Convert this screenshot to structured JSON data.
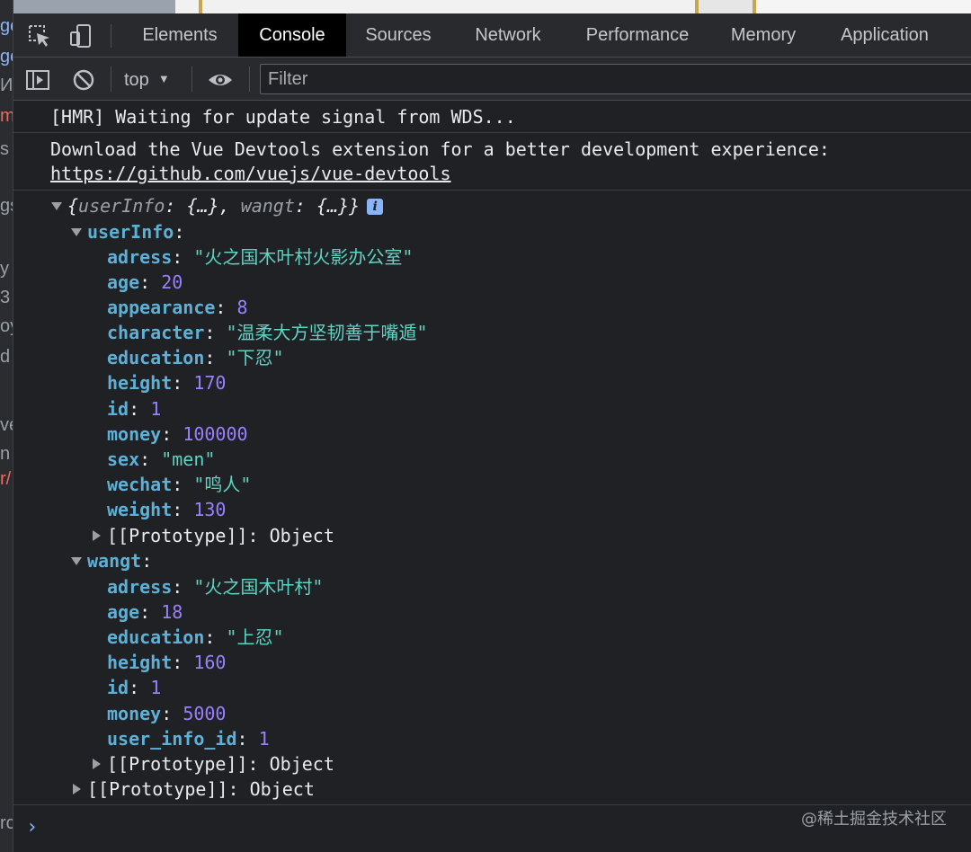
{
  "left_fragments": [
    {
      "text": "ge",
      "kind": "blue"
    },
    {
      "text": "ge",
      "kind": "blue"
    },
    {
      "text": "ИE",
      "kind": "plain"
    },
    {
      "text": "m",
      "kind": "red"
    },
    {
      "text": "s",
      "kind": "plain"
    },
    {
      "text": "gs",
      "kind": "plain"
    },
    {
      "text": "y",
      "kind": "plain"
    },
    {
      "text": "3",
      "kind": "plain"
    },
    {
      "text": "oy",
      "kind": "plain"
    },
    {
      "text": "d",
      "kind": "plain"
    },
    {
      "text": "ve",
      "kind": "plain"
    },
    {
      "text": "n",
      "kind": "plain"
    },
    {
      "text": "r/",
      "kind": "red"
    },
    {
      "text": "rc",
      "kind": "plain"
    }
  ],
  "tabs": [
    {
      "label": "Elements",
      "active": false
    },
    {
      "label": "Console",
      "active": true
    },
    {
      "label": "Sources",
      "active": false
    },
    {
      "label": "Network",
      "active": false
    },
    {
      "label": "Performance",
      "active": false
    },
    {
      "label": "Memory",
      "active": false
    },
    {
      "label": "Application",
      "active": false
    }
  ],
  "toolbar": {
    "context": "top",
    "filter_placeholder": "Filter"
  },
  "messages": {
    "hmr": "[HMR] Waiting for update signal from WDS...",
    "vue_text": "Download the Vue Devtools extension for a better development experience:",
    "vue_link": "https://github.com/vuejs/vue-devtools"
  },
  "object_preview": {
    "open": "{",
    "k1": "userInfo",
    "v1": "{…}",
    "k2": "wangt",
    "v2": "{…}",
    "close": "}",
    "info_badge": "i"
  },
  "userInfo": {
    "label": "userInfo",
    "props": [
      {
        "key": "adress",
        "value": "\"火之国木叶村火影办公室\"",
        "type": "str"
      },
      {
        "key": "age",
        "value": "20",
        "type": "num"
      },
      {
        "key": "appearance",
        "value": "8",
        "type": "num"
      },
      {
        "key": "character",
        "value": "\"温柔大方坚韧善于嘴遁\"",
        "type": "str"
      },
      {
        "key": "education",
        "value": "\"下忍\"",
        "type": "str"
      },
      {
        "key": "height",
        "value": "170",
        "type": "num"
      },
      {
        "key": "id",
        "value": "1",
        "type": "num"
      },
      {
        "key": "money",
        "value": "100000",
        "type": "num"
      },
      {
        "key": "sex",
        "value": "\"men\"",
        "type": "str"
      },
      {
        "key": "wechat",
        "value": "\"鸣人\"",
        "type": "str"
      },
      {
        "key": "weight",
        "value": "130",
        "type": "num"
      }
    ],
    "prototype": "[[Prototype]]",
    "prototype_value": "Object"
  },
  "wangt": {
    "label": "wangt",
    "props": [
      {
        "key": "adress",
        "value": "\"火之国木叶村\"",
        "type": "str"
      },
      {
        "key": "age",
        "value": "18",
        "type": "num"
      },
      {
        "key": "education",
        "value": "\"上忍\"",
        "type": "str"
      },
      {
        "key": "height",
        "value": "160",
        "type": "num"
      },
      {
        "key": "id",
        "value": "1",
        "type": "num"
      },
      {
        "key": "money",
        "value": "5000",
        "type": "num"
      },
      {
        "key": "user_info_id",
        "value": "1",
        "type": "num"
      }
    ],
    "prototype": "[[Prototype]]",
    "prototype_value": "Object"
  },
  "root_prototype": "[[Prototype]]",
  "root_prototype_value": "Object",
  "prompt_symbol": "›",
  "watermark": "@稀土掘金技术社区",
  "colors": {
    "key": "#5db0d7",
    "string": "#5cd5c4",
    "number": "#9980ff",
    "active_tab_bg": "#000000",
    "panel_bg": "#202124",
    "toolbar_bg": "#292a2d"
  }
}
